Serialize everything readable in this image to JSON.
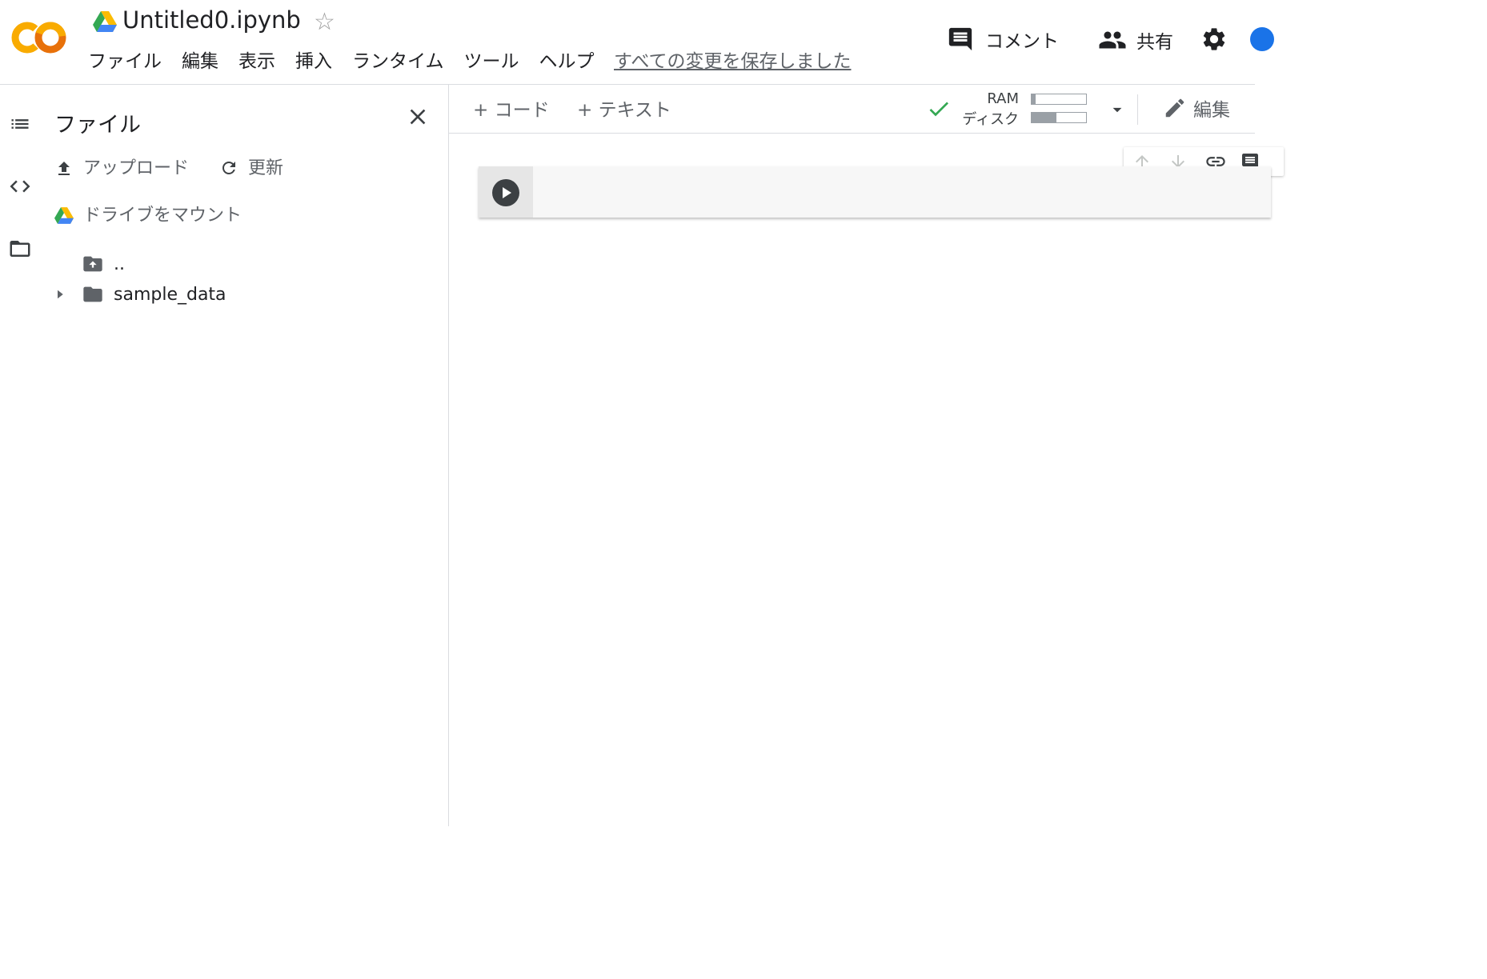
{
  "header": {
    "title": "Untitled0.ipynb",
    "menu": [
      "ファイル",
      "編集",
      "表示",
      "挿入",
      "ランタイム",
      "ツール",
      "ヘルプ"
    ],
    "saved_status": "すべての変更を保存しました",
    "comment_label": "コメント",
    "share_label": "共有"
  },
  "sidepanel": {
    "title": "ファイル",
    "upload_label": "アップロード",
    "refresh_label": "更新",
    "mount_label": "ドライブをマウント",
    "tree": {
      "parent_label": "..",
      "folder_label": "sample_data"
    }
  },
  "toolbar": {
    "add_code_label": "+ コード",
    "add_text_label": "+ テキスト",
    "ram_label": "RAM",
    "disk_label": "ディスク",
    "ram_usage_fraction": 0.08,
    "disk_usage_fraction": 0.45,
    "edit_label": "編集"
  },
  "colors": {
    "logo_orange": "#F9AB00",
    "logo_dark_orange": "#E8710A",
    "connected_check": "#34a853",
    "icon_gray": "#5f6368"
  },
  "icons": {
    "rail": [
      "toc-icon",
      "code-snippets-icon",
      "folder-icon"
    ],
    "cell_toolbar": [
      "arrow-up-icon",
      "arrow-down-icon",
      "link-icon",
      "comment-icon"
    ]
  }
}
